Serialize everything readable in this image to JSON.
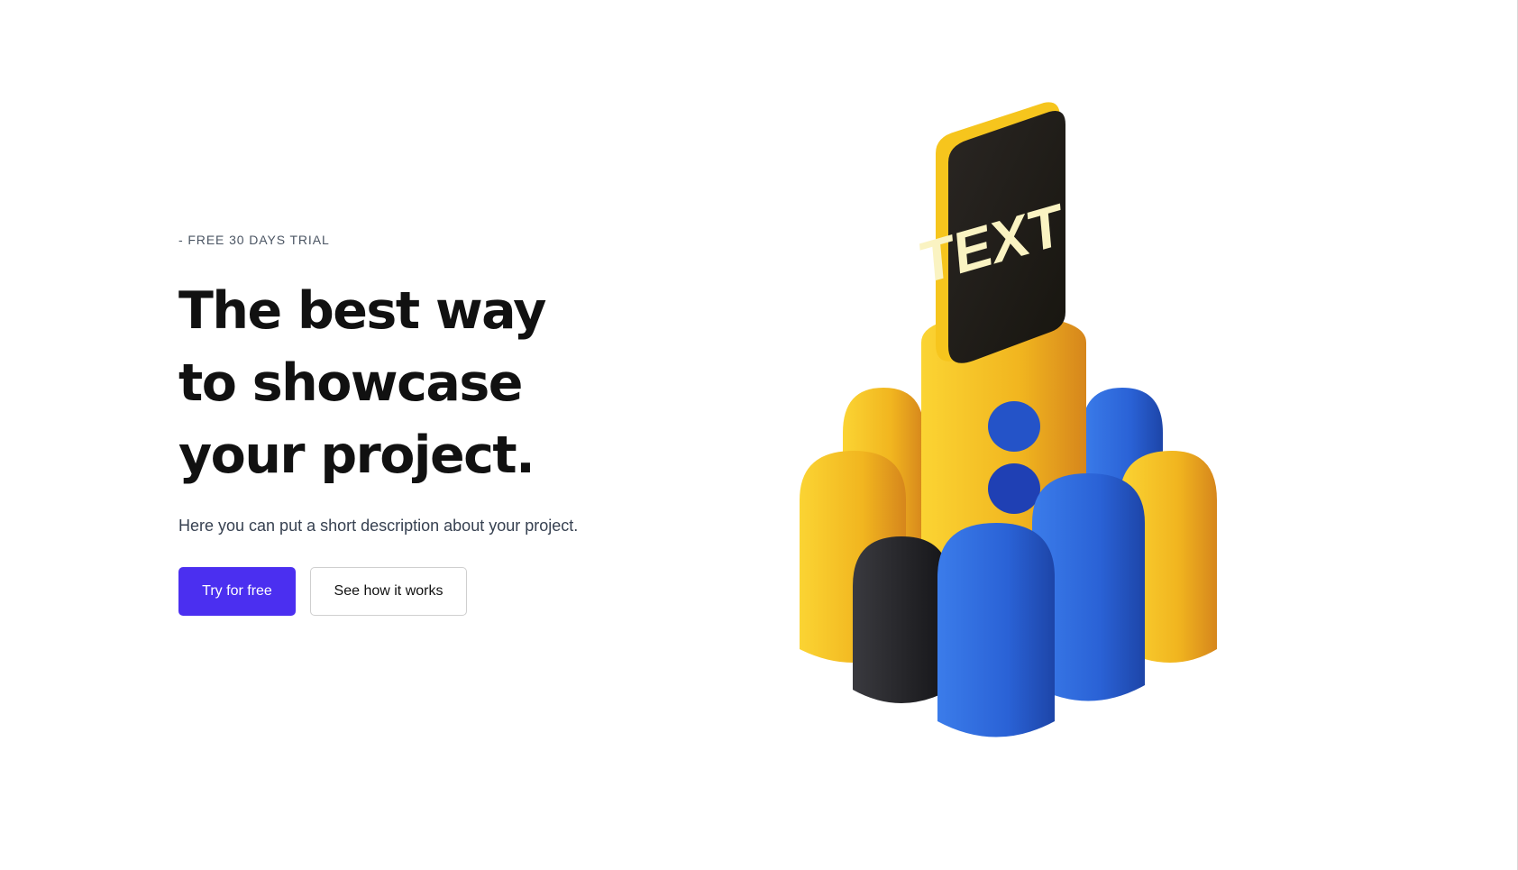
{
  "hero": {
    "eyebrow": "- FREE 30 DAYS TRIAL",
    "title_lines": [
      "The best way",
      "to showcase",
      "your project."
    ],
    "description": "Here you can put a short description about your project."
  },
  "actions": {
    "primary_label": "Try for free",
    "secondary_label": "See how it works"
  },
  "illustration": {
    "sign_text": "TEXT"
  },
  "colors": {
    "primary": "#4b2ff0",
    "yellow": "#f4c21f",
    "blue": "#2f6fe0",
    "dark": "#1f1f22"
  }
}
